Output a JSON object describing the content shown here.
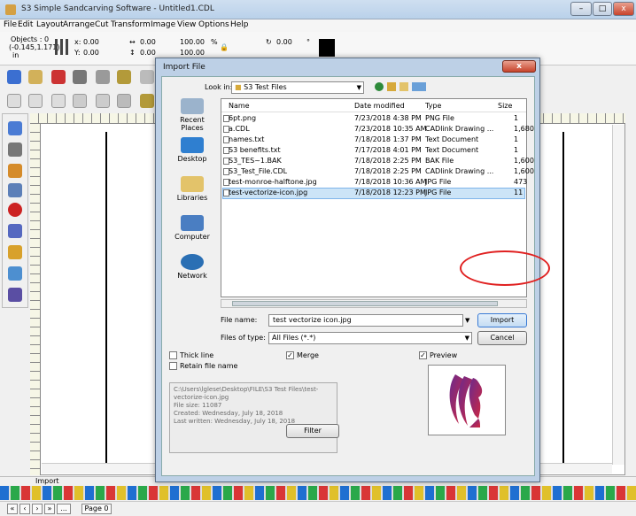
{
  "app": {
    "title": "S3 Simple Sandcarving Software - Untitled1.CDL",
    "minimize": "–",
    "maximize": "□",
    "close": "x"
  },
  "menu": [
    "File",
    "Edit",
    "Layout",
    "Arrange",
    "Cut",
    "Transform",
    "Image",
    "View",
    "Options",
    "Help"
  ],
  "props": {
    "objects": "Objects : 0",
    "coords": "(-0.145,1.171)",
    "unit": "in",
    "x_label": "x:",
    "x_value": "0.00",
    "y_label": "Y:",
    "y_value": "0.00",
    "w_value": "0.00",
    "h_value": "0.00",
    "scale_w": "100.00",
    "scale_h": "100.00",
    "pct": "%",
    "rotation": "0.00",
    "deg": "°"
  },
  "status": {
    "text": "Import"
  },
  "pagebar": {
    "first": "«",
    "prev": "‹",
    "next": "›",
    "last": "»",
    "more": "...",
    "page": "Page 0"
  },
  "dialog": {
    "title": "Import File",
    "close": "x",
    "look_in_label": "Look in:",
    "look_in_value": "S3 Test Files",
    "places": [
      "Recent Places",
      "Desktop",
      "Libraries",
      "Computer",
      "Network"
    ],
    "columns": [
      "Name",
      "Date modified",
      "Type",
      "Size"
    ],
    "files": [
      {
        "name": "6pt.png",
        "date": "7/23/2018 4:38 PM",
        "type": "PNG File",
        "size": "1"
      },
      {
        "name": "a.CDL",
        "date": "7/23/2018 10:35 AM",
        "type": "CADlink Drawing ...",
        "size": "1,680"
      },
      {
        "name": "names.txt",
        "date": "7/18/2018 1:37 PM",
        "type": "Text Document",
        "size": "1"
      },
      {
        "name": "S3 benefits.txt",
        "date": "7/17/2018 4:01 PM",
        "type": "Text Document",
        "size": "1"
      },
      {
        "name": "S3_TES~1.BAK",
        "date": "7/18/2018 2:25 PM",
        "type": "BAK File",
        "size": "1,600"
      },
      {
        "name": "S3_Test_File.CDL",
        "date": "7/18/2018 2:25 PM",
        "type": "CADlink Drawing ...",
        "size": "1,600"
      },
      {
        "name": "test-monroe-halftone.jpg",
        "date": "7/18/2018 10:36 AM",
        "type": "JPG File",
        "size": "473"
      },
      {
        "name": "test-vectorize-icon.jpg",
        "date": "7/18/2018 12:23 PM",
        "type": "JPG File",
        "size": "11"
      }
    ],
    "selected_index": 7,
    "file_name_label": "File name:",
    "file_name_value": "test vectorize icon.jpg",
    "file_type_label": "Files of type:",
    "file_type_value": "All Files (*.*)",
    "import_button": "Import",
    "cancel_button": "Cancel",
    "thick_line": "Thick line",
    "retain_name": "Retain file name",
    "merge": "Merge",
    "preview": "Preview",
    "info_lines": [
      "C:\\Users\\lglese\\Desktop\\FILE\\S3 Test Files\\test-",
      "vectorize-icon.jpg",
      "File size: 11087",
      "Created: Wednesday, July 18, 2018",
      "Last written: Wednesday, July 18, 2018"
    ],
    "filter_button": "Filter"
  },
  "colors": {
    "highlight": "#e02020",
    "selection": "#cce4f7"
  }
}
